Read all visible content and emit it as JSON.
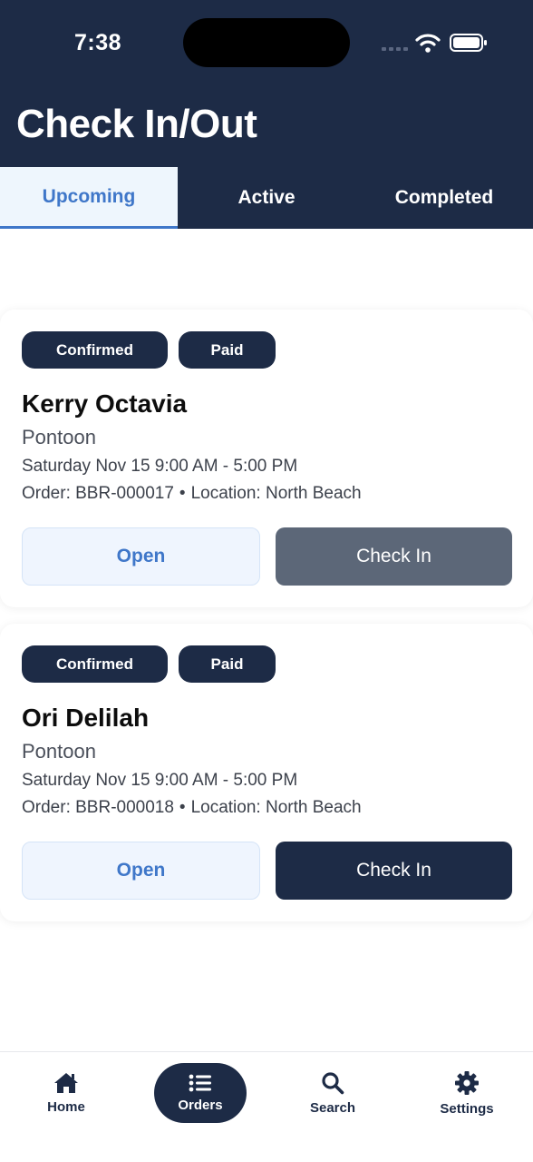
{
  "status_bar": {
    "time": "7:38"
  },
  "header": {
    "title": "Check In/Out"
  },
  "tabs": [
    {
      "label": "Upcoming",
      "active": true
    },
    {
      "label": "Active",
      "active": false
    },
    {
      "label": "Completed",
      "active": false
    }
  ],
  "bookings": [
    {
      "badges": [
        "Confirmed",
        "Paid"
      ],
      "name": "Kerry Octavia",
      "vessel": "Pontoon",
      "schedule": "Saturday Nov 15 9:00 AM - 5:00 PM",
      "order": "Order: BBR-000017",
      "location": "Location: North Beach",
      "open_label": "Open",
      "checkin_label": "Check In"
    },
    {
      "badges": [
        "Confirmed",
        "Paid"
      ],
      "name": "Ori Delilah",
      "vessel": "Pontoon",
      "schedule": "Saturday Nov 15 9:00 AM - 5:00 PM",
      "order": "Order: BBR-000018",
      "location": "Location: North Beach",
      "open_label": "Open",
      "checkin_label": "Check In"
    }
  ],
  "separator": "•",
  "bottom_nav": [
    {
      "label": "Home",
      "icon": "home-icon",
      "active": false
    },
    {
      "label": "Orders",
      "icon": "list-icon",
      "active": true
    },
    {
      "label": "Search",
      "icon": "search-icon",
      "active": false
    },
    {
      "label": "Settings",
      "icon": "gear-icon",
      "active": false
    }
  ],
  "colors": {
    "navy": "#1d2b46",
    "accent_blue": "#3f77c9",
    "open_button_bg": "#eff5fe",
    "disabled_checkin": "#5c6778"
  }
}
